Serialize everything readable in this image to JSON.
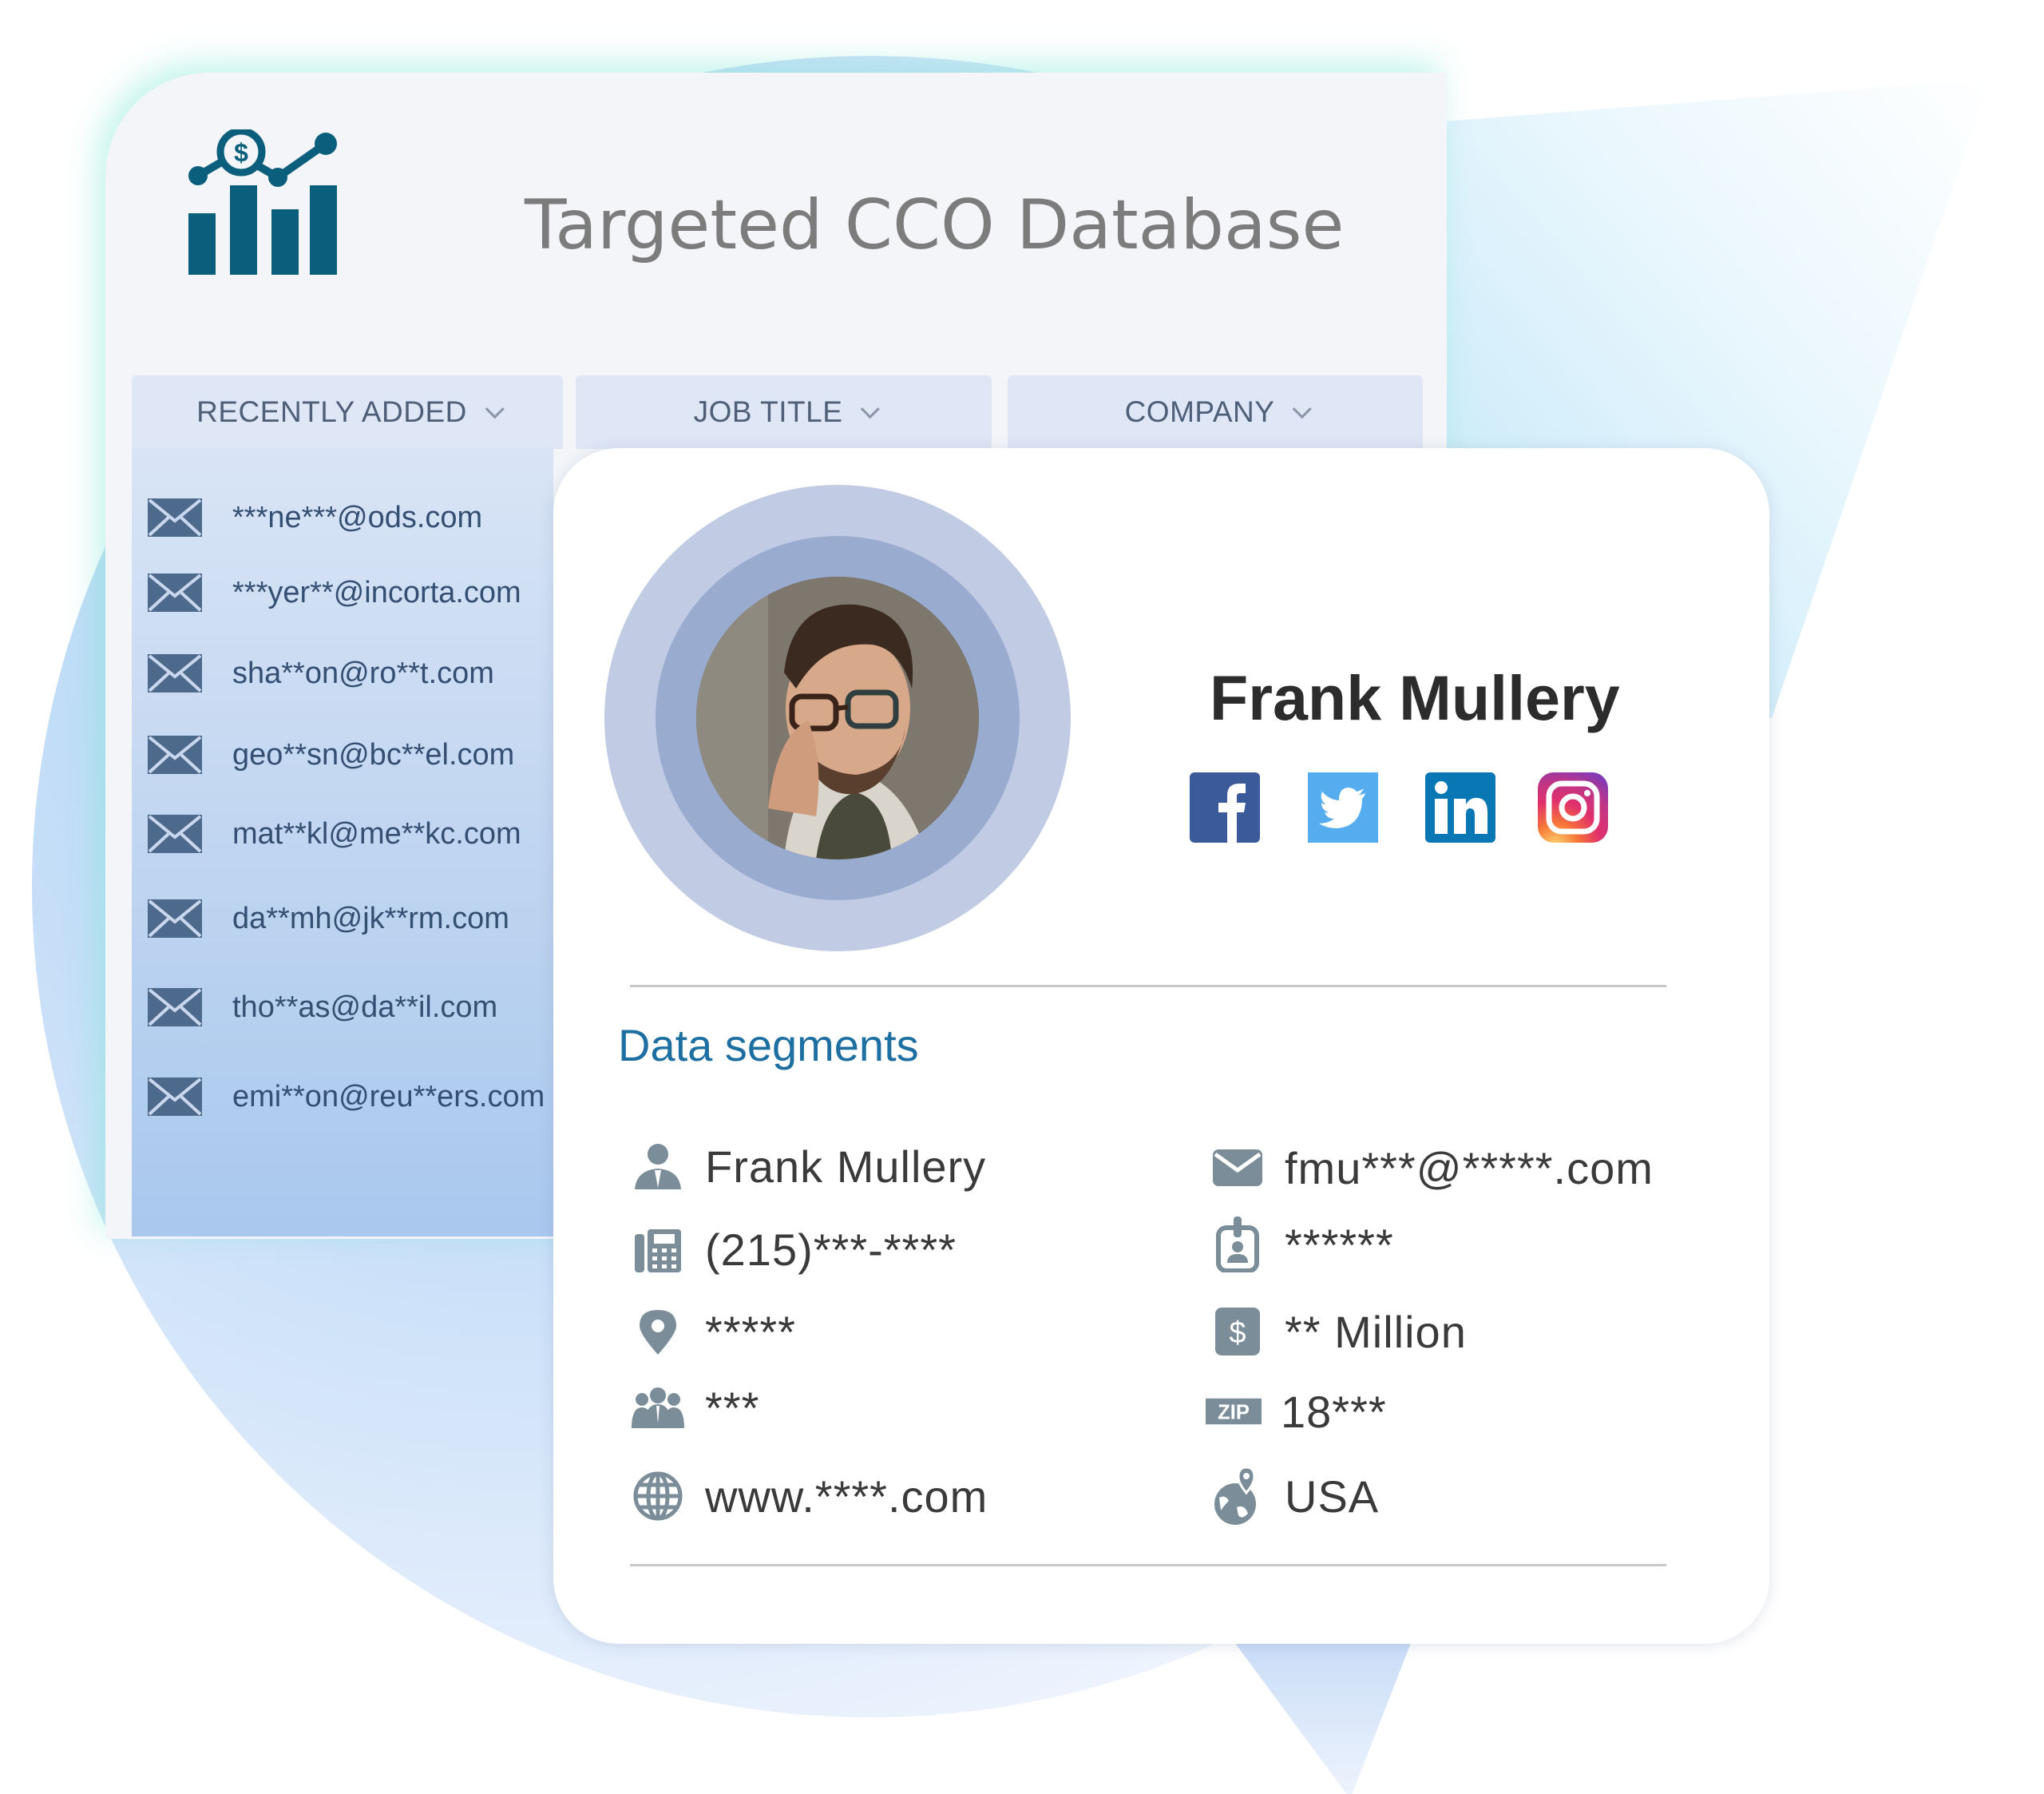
{
  "header": {
    "title": "Targeted CCO Database",
    "logo_icon": "chart-dollar-icon"
  },
  "tabs": [
    {
      "label": "RECENTLY ADDED",
      "icon": "chevron-down-icon"
    },
    {
      "label": "JOB TITLE",
      "icon": "chevron-down-icon"
    },
    {
      "label": "COMPANY",
      "icon": "chevron-down-icon"
    }
  ],
  "recent_emails": [
    {
      "icon": "envelope-icon",
      "email": "***ne***@ods.com"
    },
    {
      "icon": "envelope-icon",
      "email": "***yer**@incorta.com"
    },
    {
      "icon": "envelope-icon",
      "email": "sha**on@ro**t.com"
    },
    {
      "icon": "envelope-icon",
      "email": "geo**sn@bc**el.com"
    },
    {
      "icon": "envelope-icon",
      "email": "mat**kl@me**kc.com"
    },
    {
      "icon": "envelope-icon",
      "email": "da**mh@jk**rm.com"
    },
    {
      "icon": "envelope-icon",
      "email": "tho**as@da**il.com"
    },
    {
      "icon": "envelope-icon",
      "email": "emi**on@reu**ers.com"
    }
  ],
  "profile": {
    "name": "Frank Mullery",
    "social": [
      {
        "name": "facebook",
        "icon": "facebook-icon",
        "color": "#3b5a9a"
      },
      {
        "name": "twitter",
        "icon": "twitter-icon",
        "color": "#55acee"
      },
      {
        "name": "linkedin",
        "icon": "linkedin-icon",
        "color": "#0a77b5"
      },
      {
        "name": "instagram",
        "icon": "instagram-icon",
        "color": "#e1306c"
      }
    ]
  },
  "segments": {
    "title": "Data segments",
    "left": [
      {
        "icon": "person-icon",
        "value": "Frank Mullery"
      },
      {
        "icon": "phone-fax-icon",
        "value": "(215)***-****"
      },
      {
        "icon": "location-pin-icon",
        "value": "*****"
      },
      {
        "icon": "team-icon",
        "value": "***"
      },
      {
        "icon": "globe-icon",
        "value": "www.****.com"
      }
    ],
    "right": [
      {
        "icon": "envelope-icon",
        "value": "fmu***@*****.com"
      },
      {
        "icon": "id-badge-icon",
        "value": "******"
      },
      {
        "icon": "dollar-icon",
        "value": "** Million"
      },
      {
        "icon": "zip-icon",
        "value": "18***"
      },
      {
        "icon": "globe-pin-icon",
        "value": "USA"
      }
    ]
  },
  "colors": {
    "logo": "#0b5f7c",
    "segment_title": "#1e6fa1",
    "icon_gray": "#7a8d99",
    "email_text": "#354f73"
  }
}
